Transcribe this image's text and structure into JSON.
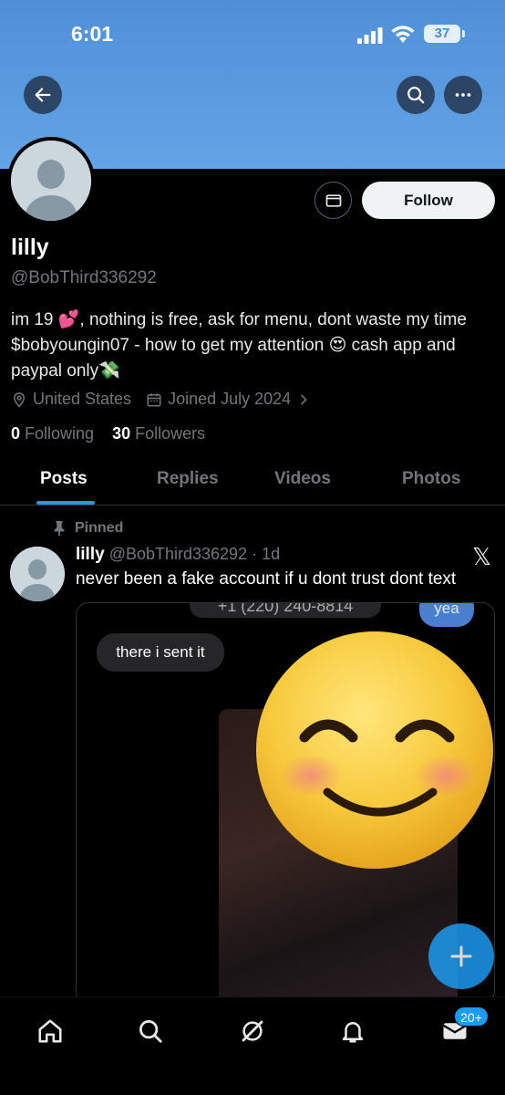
{
  "status_bar": {
    "time": "6:01",
    "battery": "37"
  },
  "profile": {
    "name": "lilly",
    "handle": "@BobThird336292",
    "bio": "im 19 💕, nothing is free, ask for menu, dont waste my time $bobyoungin07 - how to get my attention 😍 cash app and paypal only💸",
    "location": "United States",
    "joined": "Joined July 2024",
    "following_count": "0",
    "following_label": "Following",
    "followers_count": "30",
    "followers_label": "Followers",
    "follow_button": "Follow"
  },
  "tabs": [
    "Posts",
    "Replies",
    "Videos",
    "Photos"
  ],
  "pinned_post": {
    "pinned_label": "Pinned",
    "author": "lilly",
    "handle": "@BobThird336292",
    "time": "· 1d",
    "text": "never been a fake account if u dont trust dont text",
    "media": {
      "phone_partial": "+1 (220) 240-8814",
      "bubble_right": "yea",
      "bubble_left": "there i sent it"
    }
  },
  "bottom_nav": {
    "messages_badge": "20+"
  },
  "colors": {
    "accent": "#1d9bf0",
    "banner": "#5a9be0",
    "background": "#000000"
  }
}
